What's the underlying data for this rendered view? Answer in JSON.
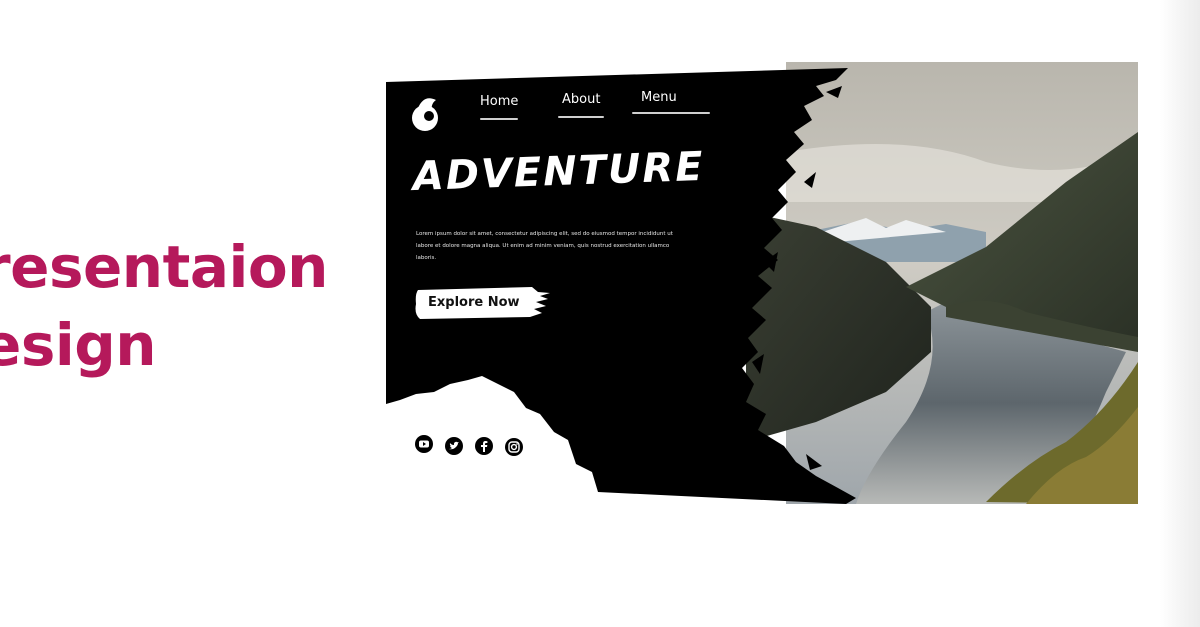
{
  "heading": {
    "line1": "resentaion",
    "line2": "esign"
  },
  "hero": {
    "nav": [
      {
        "label": "Home"
      },
      {
        "label": "About"
      },
      {
        "label": "Menu"
      }
    ],
    "title": "ADVENTURE",
    "body": "Lorem ipsum dolor sit amet, consectetur adipiscing elit, sed do eiusmod tempor incididunt ut labore et dolore magna aliqua. Ut enim ad minim veniam, quis nostrud exercitation ullamco laboris.",
    "cta_label": "Explore Now",
    "socials": [
      {
        "icon": "youtube-icon"
      },
      {
        "icon": "twitter-icon"
      },
      {
        "icon": "facebook-icon"
      },
      {
        "icon": "instagram-icon"
      }
    ]
  },
  "colors": {
    "accent": "#b5195b",
    "hero_bg": "#000000",
    "text_light": "#ffffff"
  }
}
